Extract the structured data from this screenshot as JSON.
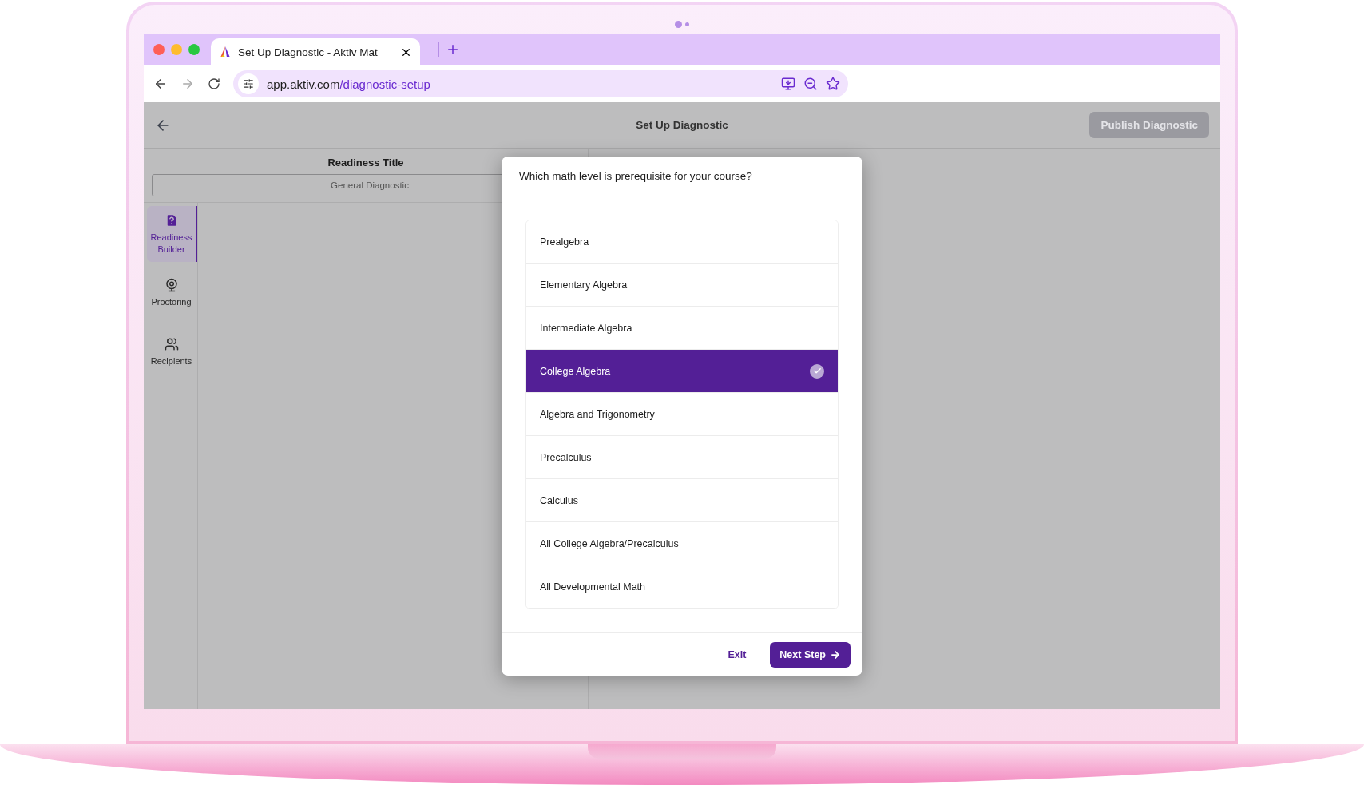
{
  "browser": {
    "tab_title": "Set Up Diagnostic - Aktiv Mat",
    "url_host": "app.aktiv.com",
    "url_path": "/diagnostic-setup"
  },
  "header": {
    "title": "Set Up Diagnostic",
    "publish_button": {
      "label": "Publish Diagnostic",
      "disabled": true
    }
  },
  "readiness": {
    "title": "Readiness Title",
    "value": "General Diagnostic"
  },
  "sidebar": {
    "items": [
      {
        "label": "Readiness Builder",
        "kind": "builder",
        "selected": true
      },
      {
        "label": "Proctoring",
        "kind": "proctoring",
        "selected": false
      },
      {
        "label": "Recipients",
        "kind": "recipients",
        "selected": false
      }
    ]
  },
  "dialog": {
    "question": "Which math level is prerequisite for your course?",
    "options": [
      {
        "label": "Prealgebra",
        "selected": false
      },
      {
        "label": "Elementary Algebra",
        "selected": false
      },
      {
        "label": "Intermediate Algebra",
        "selected": false
      },
      {
        "label": "College Algebra",
        "selected": true
      },
      {
        "label": "Algebra and Trigonometry",
        "selected": false
      },
      {
        "label": "Precalculus",
        "selected": false
      },
      {
        "label": "Calculus",
        "selected": false
      },
      {
        "label": "All College Algebra/Precalculus",
        "selected": false
      },
      {
        "label": "All Developmental Math",
        "selected": false
      }
    ],
    "exit": "Exit",
    "next": "Next Step"
  }
}
